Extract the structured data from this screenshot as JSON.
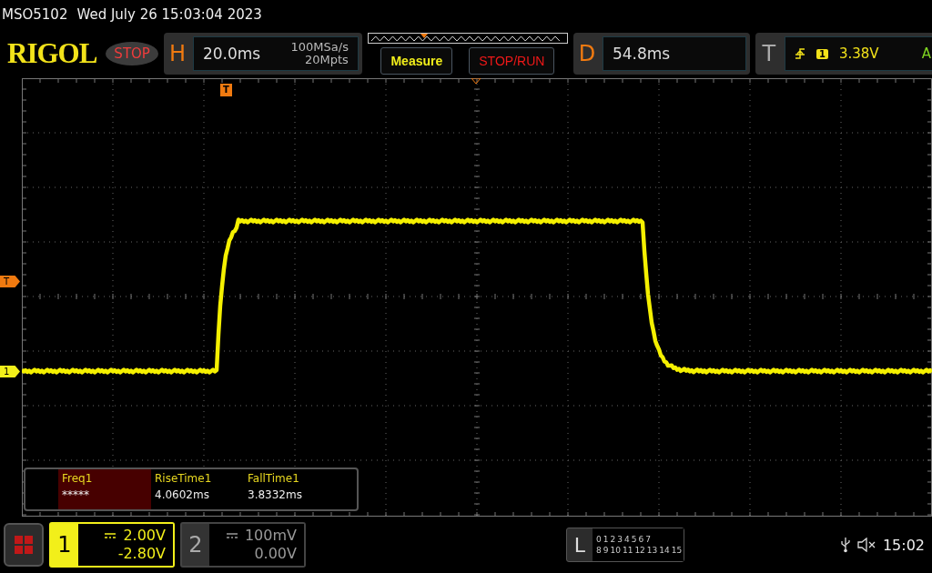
{
  "status_line": {
    "model": "MSO5102",
    "datetime": "Wed July 26 15:03:04 2023"
  },
  "toolbar": {
    "logo": "RIGOL",
    "run_state": "STOP",
    "horizontal": {
      "label": "H",
      "timebase": "20.0ms",
      "sample_rate": "100MSa/s",
      "memory_depth": "20Mpts"
    },
    "buttons": [
      {
        "label": "Measure",
        "kind": "measure"
      },
      {
        "label": "STOP/RUN",
        "kind": "stoprun"
      }
    ],
    "delay": {
      "label": "D",
      "value": "54.8ms"
    },
    "trigger": {
      "label": "T",
      "source": "1",
      "level": "3.38V",
      "mode": "A"
    }
  },
  "trigger_position_marker": "T",
  "side_markers": [
    {
      "label": "T",
      "kind": "trigger"
    },
    {
      "label": "1",
      "kind": "channel"
    }
  ],
  "measurements": [
    {
      "name": "Freq1",
      "value": "*****",
      "selected": true
    },
    {
      "name": "RiseTime1",
      "value": "4.0602ms",
      "selected": false
    },
    {
      "name": "FallTime1",
      "value": "3.8332ms",
      "selected": false
    }
  ],
  "channels": [
    {
      "number": "1",
      "scale": "2.00V",
      "offset": "-2.80V",
      "selected": true
    },
    {
      "number": "2",
      "scale": "100mV",
      "offset": "0.00V",
      "selected": false
    }
  ],
  "logic": {
    "label": "L",
    "row_1": [
      "0",
      "1",
      "2",
      "3",
      "4",
      "5",
      "6",
      "7"
    ],
    "row_2": [
      "8",
      "9",
      "10",
      "11",
      "12",
      "13",
      "14",
      "15"
    ]
  },
  "status_bar": {
    "time": "15:02"
  }
}
